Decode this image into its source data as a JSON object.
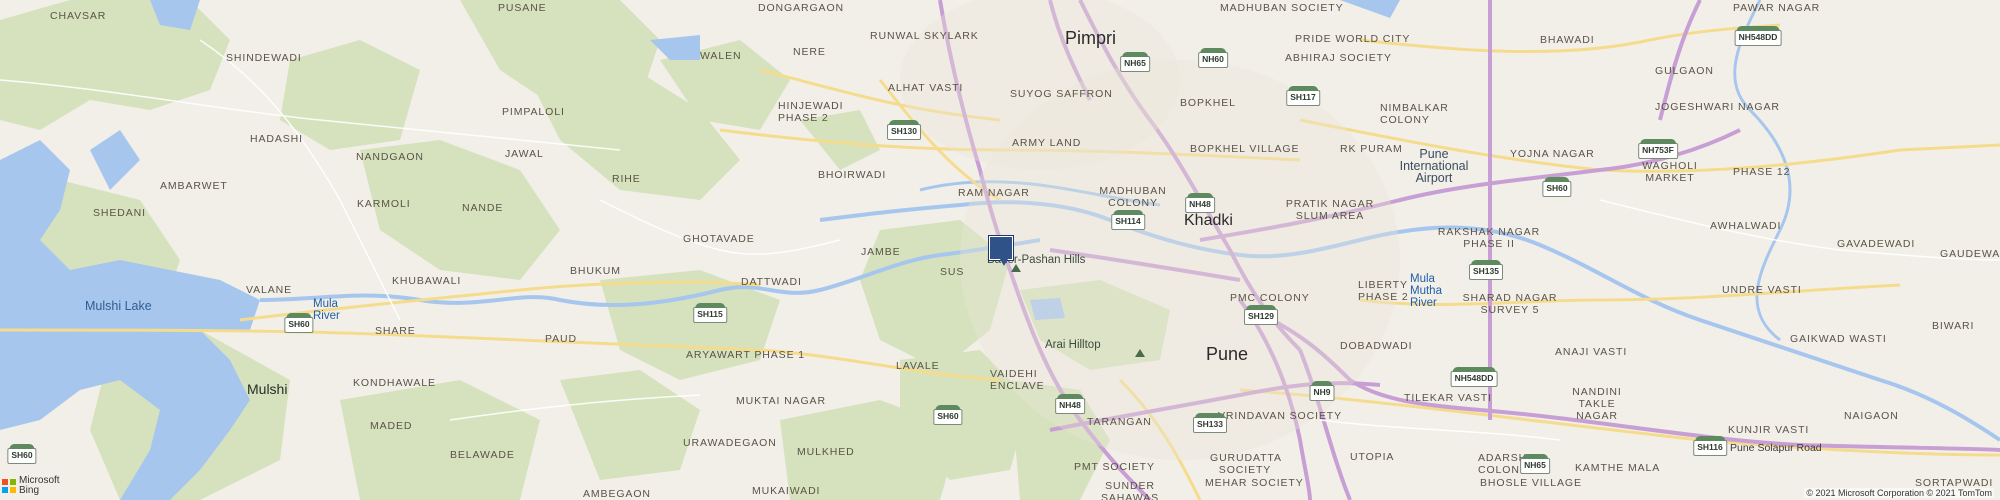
{
  "map": {
    "center_marker": "location-pin",
    "labels": {
      "chavsar": "CHAVSAR",
      "pusane": "PUSANE",
      "dongargaon": "DONGARGAON",
      "pimpri": "Pimpri",
      "madhuban_society": "MADHUBAN SOCIETY",
      "runwal_skylark": "RUNWAL SKYLARK",
      "walen": "WALEN",
      "nere": "NERE",
      "pride_world_city": "PRIDE WORLD CITY",
      "bhawadi": "BHAWADI",
      "pawar_nagar": "PAWAR NAGAR",
      "gulgaon": "GULGAON",
      "shindewadi": "SHINDEWADI",
      "abhiraj_society": "ABHIRAJ SOCIETY",
      "alhat_vasti": "ALHAT VASTI",
      "suyog_saffron": "SUYOG SAFFRON",
      "hinjewadi_phase2": "HINJEWADI PHASE 2",
      "bopkhel": "BOPKHEL",
      "nimbalkar_colony": "NIMBALKAR COLONY",
      "jogeshwari_nagar": "JOGESHWARI NAGAR",
      "pimpaloli": "PIMPALOLI",
      "hadashi": "HADASHI",
      "army_land": "ARMY LAND",
      "bopkhel_village": "BOPKHEL VILLAGE",
      "jawal": "JAWAL",
      "nandgaon": "NANDGAON",
      "rk_puram": "RK PURAM",
      "yojna_nagar": "YOJNA NAGAR",
      "wagholi_market": "WAGHOLI MARKET",
      "pune_international_airport": "Pune International Airport",
      "phase_12": "PHASE 12",
      "bhoirwadi": "BHOIRWADI",
      "rihe": "RIHE",
      "ambarwet": "AMBARWET",
      "ram_nagar": "RAM NAGAR",
      "madhuban_colony": "MADHUBAN COLONY",
      "pratik_nagar": "PRATIK NAGAR SLUM AREA",
      "karmoli": "KARMOLI",
      "nande": "NANDE",
      "shedani": "SHEDANI",
      "khadki": "Khadki",
      "awhalwadi": "AWHALWADI",
      "rakshak_nagar": "RAKSHAK NAGAR PHASE II",
      "gavadewadi": "GAVADEWADI",
      "ghotavade": "GHOTAVADE",
      "jambe": "JAMBE",
      "baner_pashan_hills": "Baner-Pashan Hills",
      "gaudewadi": "GAUDEWADI",
      "bhukum": "BHUKUM",
      "sus": "SUS",
      "khubawali": "KHUBAWALI",
      "dattwadi": "DATTWADI",
      "valane": "VALANE",
      "liberty_phase2": "LIBERTY PHASE 2",
      "mula_mutha_river": "Mula Mutha River",
      "undre_vasti": "UNDRE VASTI",
      "mulshi_lake": "Mulshi Lake",
      "mula_river": "Mula River",
      "pmc_colony": "PMC COLONY",
      "sharad_nagar": "SHARAD NAGAR SURVEY 5",
      "biwari": "BIWARI",
      "share": "SHARE",
      "gaikwad_wasti": "GAIKWAD WASTI",
      "paud": "PAUD",
      "aryawart_phase1": "ARYAWART PHASE 1",
      "arai_hilltop": "Arai Hilltop",
      "dobadwadi": "DOBADWADI",
      "anaji_vasti": "ANAJI VASTI",
      "pune": "Pune",
      "kondhawale": "KONDHAWALE",
      "lavale": "LAVALE",
      "mulshi": "Mulshi",
      "vaidehi_enclave": "VAIDEHI ENCLAVE",
      "mukta_nagar": "MUKTAI NAGAR",
      "tilekar_vasti": "TILEKAR VASTI",
      "nandini_takle_nagar": "NANDINI TAKLE NAGAR",
      "naigaon": "NAIGAON",
      "kunjir_vasti": "KUNJIR VASTI",
      "maded": "MADED",
      "tarangan": "TARANGAN",
      "vrindavan_society": "VRINDAVAN SOCIETY",
      "belawade": "BELAWADE",
      "urawadegaon": "URAWADEGAON",
      "pune_solapur_road": "Pune Solapur Road",
      "mulkhed": "MULKHED",
      "gurudatta_society": "GURUDATTA SOCIETY",
      "utopia": "UTOPIA",
      "adarsh_colony": "ADARSH COLONY",
      "kamthe_mala": "KAMTHE MALA",
      "sortapwadi": "SORTAPWADI",
      "pmt_society": "PMT SOCIETY",
      "mehar_society": "MEHAR SOCIETY",
      "bhosle_village": "BHOSLE VILLAGE",
      "sunder_sahawas": "SUNDER SAHAWAS",
      "ambegaon": "AMBEGAON",
      "mukaiwadi": "MUKAIWADI"
    },
    "shields": {
      "nh65_top": "NH65",
      "nh60_top": "NH60",
      "sh117": "SH117",
      "nh548dd_top": "NH548DD",
      "sh130": "SH130",
      "nh753f": "NH753F",
      "nh48_khadki": "NH48",
      "sh114": "SH114",
      "sh60_east": "SH60",
      "sh135": "SH135",
      "sh115": "SH115",
      "sh60_west": "SH60",
      "sh129": "SH129",
      "nh548dd_mid": "NH548DD",
      "nh9": "NH9",
      "sh60_south": "SH60",
      "nh48_south": "NH48",
      "sh133": "SH133",
      "sh116": "SH116",
      "nh65_south": "NH65",
      "sh60_corner": "SH60"
    }
  },
  "attribution": {
    "logo_text": "Microsoft Bing",
    "copyright": "© 2021 Microsoft Corporation © 2021 TomTom"
  },
  "colors": {
    "land": "#f2efe9",
    "forest": "#d5e2bd",
    "water": "#a7c6ee",
    "highway": "#c89fd4",
    "main_road": "#f5dc8c",
    "marker": "#2f5289"
  }
}
